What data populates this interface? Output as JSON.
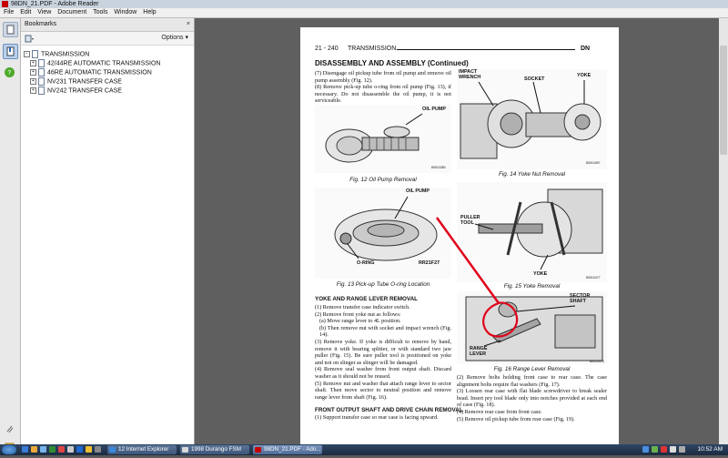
{
  "window": {
    "title": "98DN_21.PDF - Adobe Reader"
  },
  "menu": [
    "File",
    "Edit",
    "View",
    "Document",
    "Tools",
    "Window",
    "Help"
  ],
  "bookmarks": {
    "title": "Bookmarks",
    "options_label": "Options",
    "close_glyph": "×",
    "items": [
      {
        "label": "TRANSMISSION",
        "expander": "−"
      },
      {
        "label": "42/44RE AUTOMATIC TRANSMISSION",
        "expander": "+"
      },
      {
        "label": "46RE AUTOMATIC TRANSMISSION",
        "expander": "+"
      },
      {
        "label": "NV231 TRANSFER CASE",
        "expander": "+"
      },
      {
        "label": "NV242 TRANSFER CASE",
        "expander": "+"
      }
    ]
  },
  "page": {
    "page_number": "21 - 240",
    "section": "TRANSMISSION",
    "model": "DN",
    "title": "DISASSEMBLY AND ASSEMBLY (Continued)",
    "left_col_top": [
      "(7) Disengage oil pickup tube from oil pump and remove oil pump assembly (Fig. 12).",
      "(8) Remove pick-up tube o-ring from oil pump (Fig. 13), if necessary. Do not disassemble the oil pump, it is not serviceable."
    ],
    "fig12": {
      "caption": "Fig. 12 Oil Pump Removal",
      "callout": "OIL PUMP",
      "code": "80010280"
    },
    "fig13": {
      "caption": "Fig. 13 Pick-up Tube O-ring Location",
      "callout_top": "OIL PUMP",
      "callout_bottom": "O-RING",
      "code": "RR21F27"
    },
    "fig14": {
      "caption": "Fig. 14 Yoke Nut Removal",
      "callouts": [
        "IMPACT WRENCH",
        "SOCKET",
        "YOKE"
      ],
      "code": "80010287"
    },
    "fig15": {
      "caption": "Fig. 15 Yoke Removal",
      "callouts": [
        "PULLER TOOL",
        "YOKE"
      ],
      "code": "80010477"
    },
    "fig16": {
      "caption": "Fig. 16 Range Lever Removal",
      "callouts": [
        "SECTOR SHAFT",
        "RANGE LEVER"
      ],
      "code": "80010478"
    },
    "subhead1": "YOKE AND RANGE LEVER REMOVAL",
    "left_col_mid": [
      "(1) Remove transfer case indicator switch.",
      "(2) Remove front yoke nut as follows:",
      "(a) Move range lever to 4L position.",
      "(b) Then remove nut with socket and impact wrench (Fig. 14).",
      "(3) Remove yoke. If yoke is difficult to remove by hand, remove it with bearing splitter, or with standard two jaw puller (Fig. 15). Be sure puller tool is positioned on yoke and not on slinger as slinger will be damaged.",
      "(4) Remove seal washer from front output shaft. Discard washer as it should not be reused.",
      "(5) Remove nut and washer that attach range lever to sector shaft. Then move sector to neutral position and remove range lever from shaft (Fig. 16)."
    ],
    "subhead2": "FRONT OUTPUT SHAFT AND DRIVE CHAIN REMOVAL",
    "left_col_bottom": [
      "(1) Support transfer case so rear case is facing upward."
    ],
    "right_col_bottom": [
      "(2) Remove bolts holding front case to rear case. The case alignment bolts require flat washers (Fig. 17).",
      "(3) Loosen rear case with flat blade screwdriver to break sealer bead. Insert pry tool blade only into notches provided at each end of case (Fig. 18).",
      "(4) Remove rear case from front case.",
      "(5) Remove oil pickup tube from rear case (Fig. 19)."
    ]
  },
  "taskbar": {
    "items": [
      {
        "label": "12 Internet Explorer",
        "active": false
      },
      {
        "label": "1998 Durango FSM",
        "active": false
      },
      {
        "label": "98DN_21.PDF - Ado...",
        "active": true
      }
    ],
    "clock": "10:52 AM"
  },
  "colors": {
    "annotation_red": "#e0001a",
    "title_bar": "#c9d3de",
    "taskbar": "#1b2b40"
  }
}
